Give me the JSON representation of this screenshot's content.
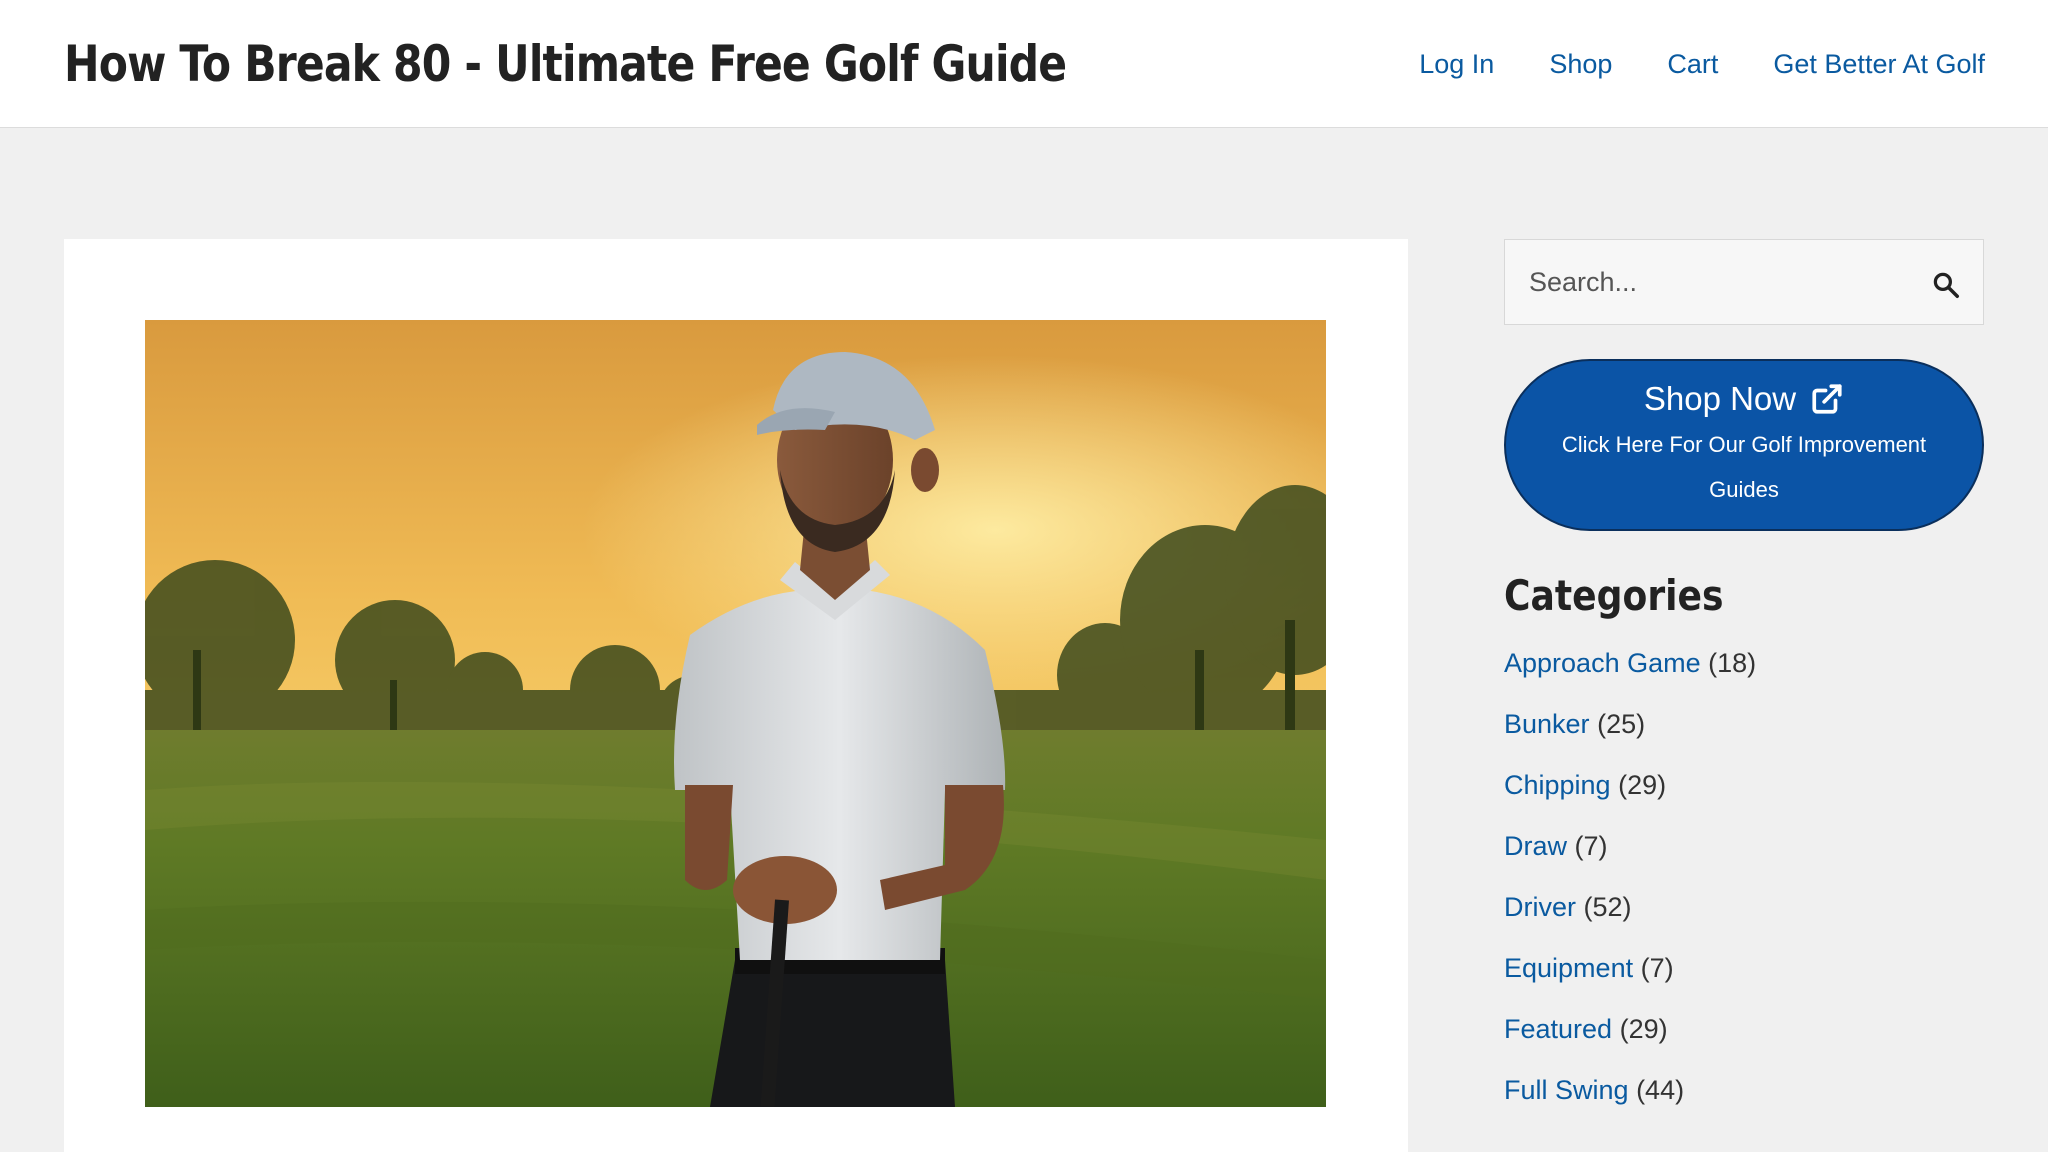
{
  "header": {
    "site_title": "How To Break 80 - Ultimate Free Golf Guide",
    "nav": [
      "Log In",
      "Shop",
      "Cart",
      "Get Better At Golf"
    ]
  },
  "sidebar": {
    "search": {
      "placeholder": "Search...",
      "icon": "search-icon"
    },
    "shop_button": {
      "title": "Shop Now",
      "subtitle": "Click Here For Our Golf Improvement Guides",
      "icon": "external-link-icon"
    },
    "categories_heading": "Categories",
    "categories": [
      {
        "name": "Approach Game",
        "count": "(18)"
      },
      {
        "name": "Bunker",
        "count": "(25)"
      },
      {
        "name": "Chipping",
        "count": "(29)"
      },
      {
        "name": "Draw",
        "count": "(7)"
      },
      {
        "name": "Driver",
        "count": "(52)"
      },
      {
        "name": "Equipment",
        "count": "(7)"
      },
      {
        "name": "Featured",
        "count": "(29)"
      },
      {
        "name": "Full Swing",
        "count": "(44)"
      }
    ]
  },
  "colors": {
    "link": "#0a5aa0",
    "button": "#0b54a6",
    "page_background": "#f0f0f0"
  }
}
